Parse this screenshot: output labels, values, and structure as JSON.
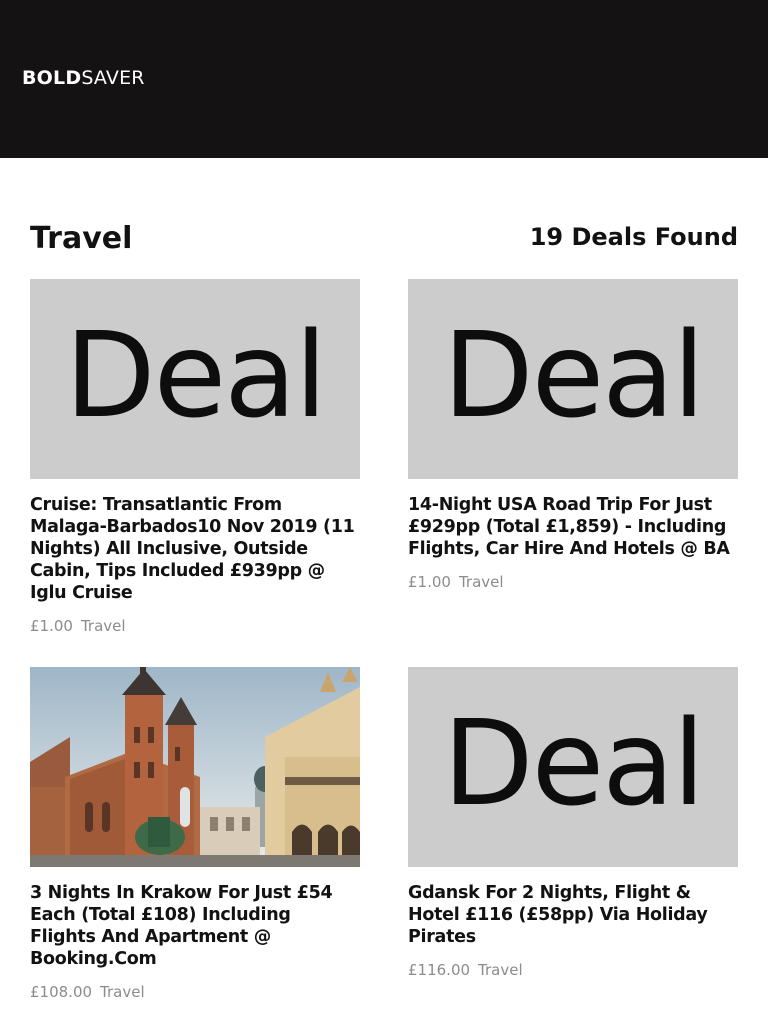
{
  "brand": {
    "bold": "BOLD",
    "light": "SAVER"
  },
  "page": {
    "title": "Travel",
    "deal_count": "19 Deals Found"
  },
  "deals": [
    {
      "image_text": "Deal",
      "title": "Cruise: Transatlantic From Malaga-Barbados10 Nov 2019 (11 Nights) All Inclusive, Outside Cabin, Tips Included £939pp @ Iglu Cruise",
      "price": "£1.00",
      "category": "Travel"
    },
    {
      "image_text": "Deal",
      "title": "14-Night USA Road Trip For Just £929pp (Total £1,859) - Including Flights, Car Hire And Hotels @ BA",
      "price": "£1.00",
      "category": "Travel"
    },
    {
      "image": "krakow-photo",
      "title": "3 Nights In Krakow For Just £54 Each (Total £108) Including Flights And Apartment @ Booking.Com",
      "price": "£108.00",
      "category": "Travel"
    },
    {
      "image_text": "Deal",
      "title": "Gdansk For 2 Nights, Flight & Hotel £116 (£58pp) Via Holiday Pirates",
      "price": "£116.00",
      "category": "Travel"
    }
  ],
  "colors": {
    "header_bg": "#141213",
    "placeholder_bg": "#cccccc",
    "text": "#121212",
    "meta": "#8c8c8c"
  }
}
